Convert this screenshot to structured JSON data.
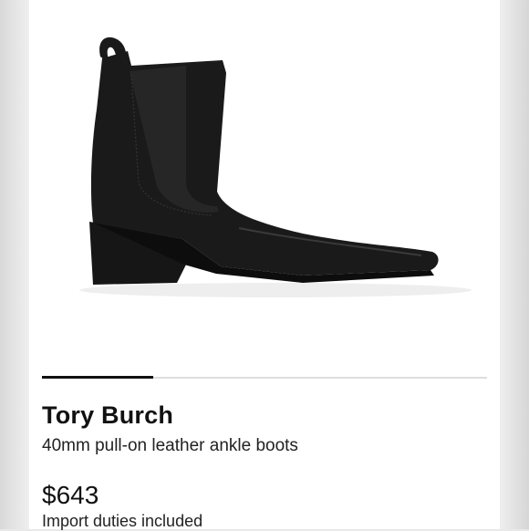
{
  "product": {
    "brand": "Tory Burch",
    "description": "40mm pull-on leather ankle boots",
    "price": "$643",
    "duties_note": "Import duties included"
  },
  "gallery": {
    "progress_fraction": 0.25,
    "image": "black-leather-chelsea-ankle-boot"
  },
  "colors": {
    "text": "#111111",
    "boot": "#1a1a1a",
    "track": "#dedede"
  }
}
